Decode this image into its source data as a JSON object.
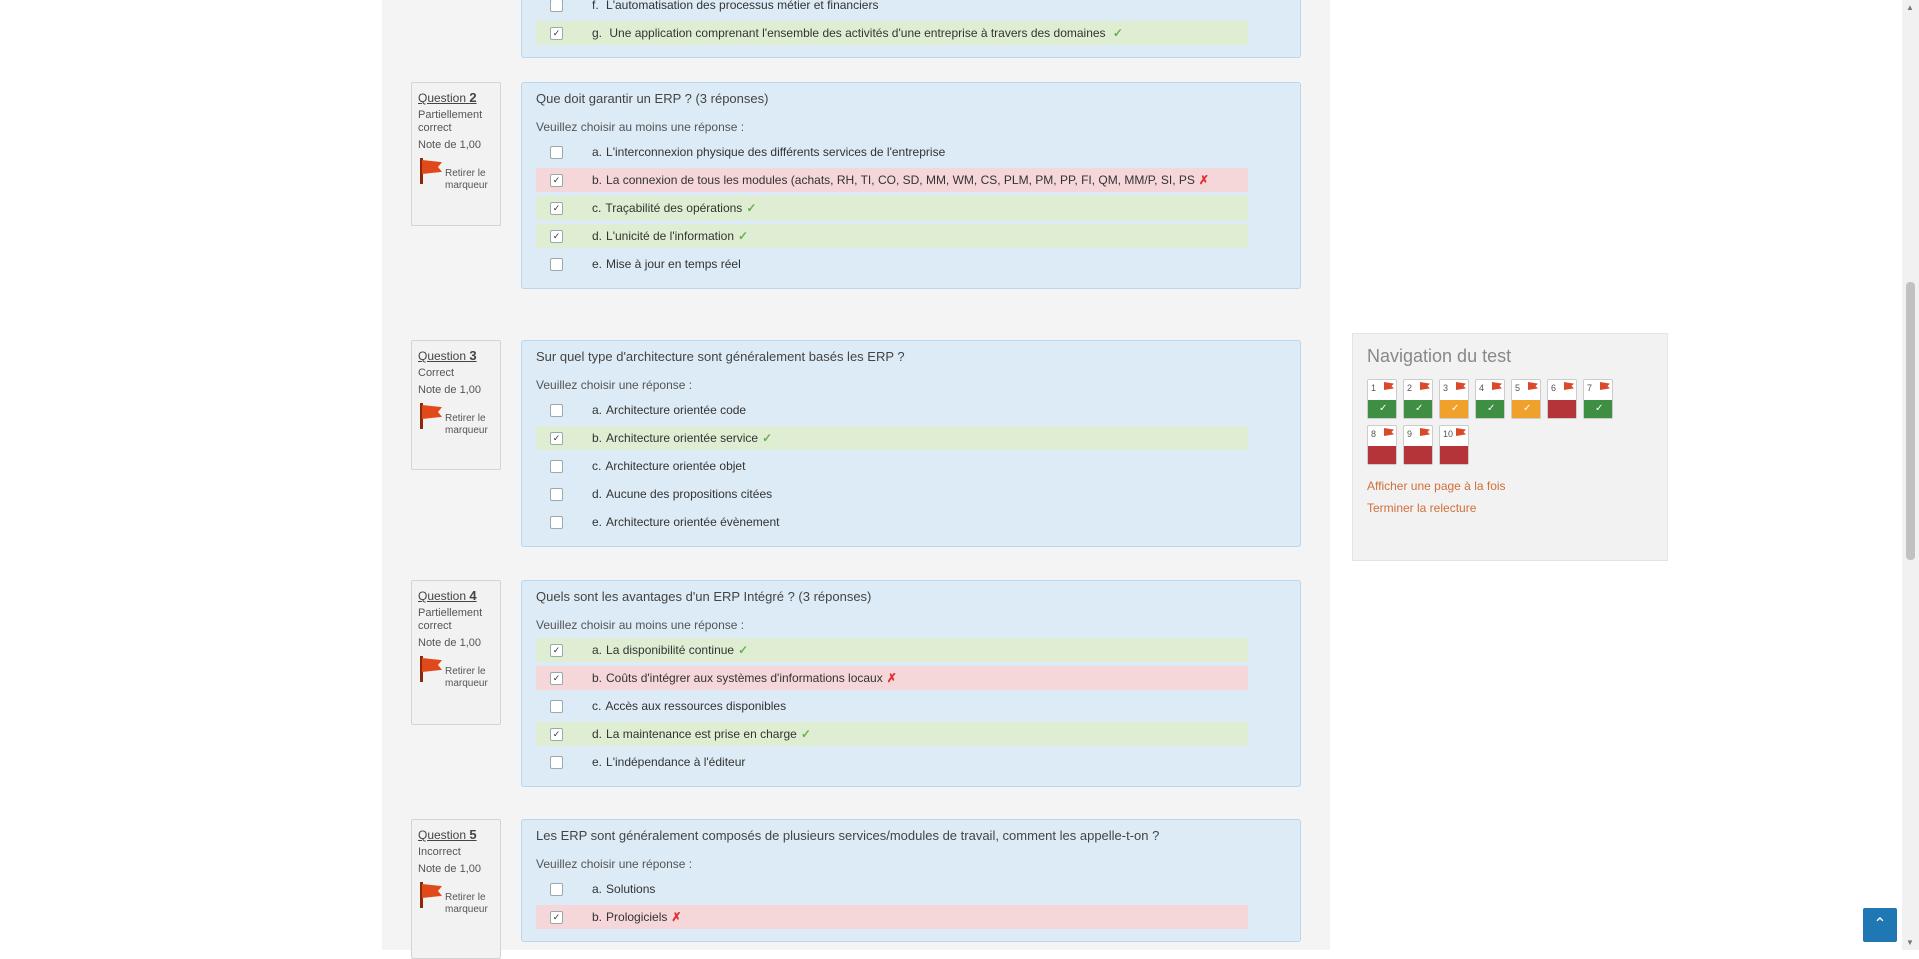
{
  "top_partial": {
    "answers": [
      {
        "letter": "f.",
        "text": "L'automatisation des processus métier et financiers",
        "status": "none"
      },
      {
        "letter": "g.",
        "text": "Une application comprenant l'ensemble des activités d'une entreprise à travers des domaines",
        "status": "correct",
        "checked": true
      }
    ]
  },
  "questions": [
    {
      "number": "2",
      "state": "Partiellement correct",
      "mark": "Note de 1,00",
      "flag_label": "Retirer le marqueur",
      "text": "Que doit garantir un ERP ? (3 réponses)",
      "prompt": "Veuillez choisir au moins une réponse :",
      "answers": [
        {
          "letter": "a.",
          "text": "L'interconnexion physique des différents services de l'entreprise",
          "status": "none",
          "checked": false
        },
        {
          "letter": "b.",
          "text": "La connexion de tous les modules (achats, RH, TI, CO, SD, MM, WM, CS, PLM, PM, PP, FI, QM, MM/P, SI, PS",
          "status": "wrong",
          "checked": true
        },
        {
          "letter": "c.",
          "text": "Traçabilité des opérations",
          "status": "correct",
          "checked": true
        },
        {
          "letter": "d.",
          "text": "L'unicité de l'information",
          "status": "correct",
          "checked": true
        },
        {
          "letter": "e.",
          "text": "Mise à jour en temps réel",
          "status": "none",
          "checked": false
        }
      ]
    },
    {
      "number": "3",
      "state": "Correct",
      "mark": "Note de 1,00",
      "flag_label": "Retirer le marqueur",
      "text": "Sur quel type d'architecture sont généralement basés les ERP ?",
      "prompt": "Veuillez choisir une réponse :",
      "answers": [
        {
          "letter": "a.",
          "text": "Architecture orientée code",
          "status": "none",
          "checked": false
        },
        {
          "letter": "b.",
          "text": "Architecture orientée service",
          "status": "correct",
          "checked": true
        },
        {
          "letter": "c.",
          "text": "Architecture orientée objet",
          "status": "none",
          "checked": false
        },
        {
          "letter": "d.",
          "text": "Aucune des propositions citées",
          "status": "none",
          "checked": false
        },
        {
          "letter": "e.",
          "text": "Architecture orientée évènement",
          "status": "none",
          "checked": false
        }
      ]
    },
    {
      "number": "4",
      "state": "Partiellement correct",
      "mark": "Note de 1,00",
      "flag_label": "Retirer le marqueur",
      "text": "Quels sont les avantages d'un ERP Intégré ? (3 réponses)",
      "prompt": "Veuillez choisir au moins une réponse :",
      "answers": [
        {
          "letter": "a.",
          "text": "La disponibilité continue",
          "status": "correct",
          "checked": true
        },
        {
          "letter": "b.",
          "text": "Coûts d'intégrer aux systèmes d'informations locaux",
          "status": "wrong",
          "checked": true
        },
        {
          "letter": "c.",
          "text": "Accès aux ressources disponibles",
          "status": "none",
          "checked": false
        },
        {
          "letter": "d.",
          "text": "La maintenance est prise en charge",
          "status": "correct",
          "checked": true
        },
        {
          "letter": "e.",
          "text": "L'indépendance à l'éditeur",
          "status": "none",
          "checked": false
        }
      ]
    },
    {
      "number": "5",
      "state": "Incorrect",
      "mark": "Note de 1,00",
      "flag_label": "Retirer le marqueur",
      "text": "Les ERP sont généralement composés de plusieurs services/modules de travail, comment les appelle-t-on ?",
      "prompt": "Veuillez choisir une réponse :",
      "answers": [
        {
          "letter": "a.",
          "text": "Solutions",
          "status": "none",
          "checked": false
        },
        {
          "letter": "b.",
          "text": "Prologiciels",
          "status": "wrong",
          "checked": true
        }
      ]
    }
  ],
  "quiz_nav": {
    "title": "Navigation du test",
    "items": [
      {
        "num": "1",
        "result": "correct"
      },
      {
        "num": "2",
        "result": "correct"
      },
      {
        "num": "3",
        "result": "partial"
      },
      {
        "num": "4",
        "result": "correct"
      },
      {
        "num": "5",
        "result": "partial"
      },
      {
        "num": "6",
        "result": "incorrect"
      },
      {
        "num": "7",
        "result": "correct"
      },
      {
        "num": "8",
        "result": "incorrect"
      },
      {
        "num": "9",
        "result": "incorrect"
      },
      {
        "num": "10",
        "result": "incorrect"
      }
    ],
    "link_one_page": "Afficher une page à la fois",
    "link_finish": "Terminer la relecture"
  },
  "back_to_top_icon": "chevron-up-icon"
}
